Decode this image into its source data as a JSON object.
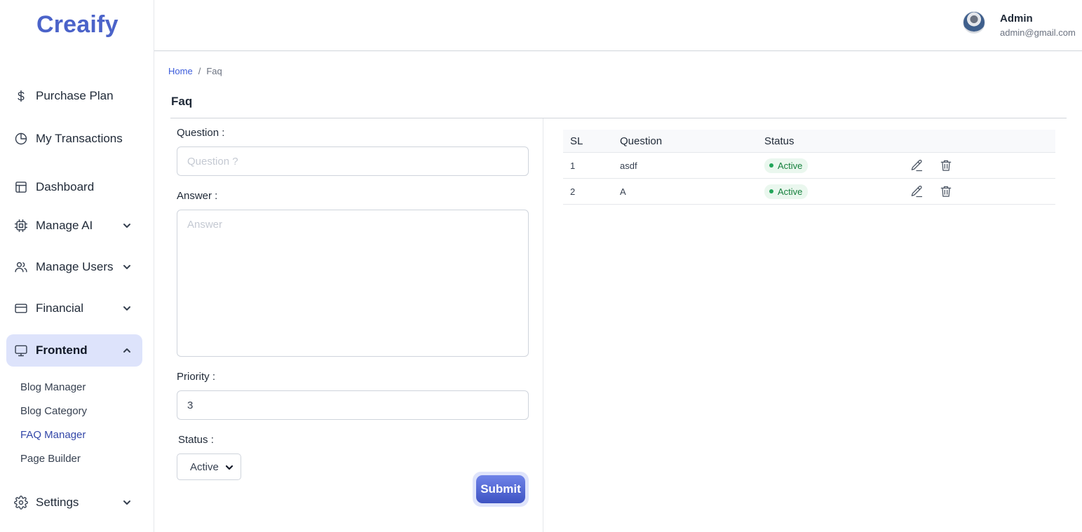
{
  "brand": {
    "name": "Creaify"
  },
  "sidebar": {
    "items": [
      {
        "label": "Purchase Plan"
      },
      {
        "label": "My Transactions"
      },
      {
        "label": "Dashboard"
      },
      {
        "label": "Manage AI"
      },
      {
        "label": "Manage Users"
      },
      {
        "label": "Financial"
      },
      {
        "label": "Frontend"
      },
      {
        "label": "Settings"
      }
    ],
    "frontend_sub": [
      {
        "label": "Blog Manager"
      },
      {
        "label": "Blog Category"
      },
      {
        "label": "FAQ Manager"
      },
      {
        "label": "Page Builder"
      }
    ]
  },
  "user": {
    "name": "Admin",
    "email": "admin@gmail.com"
  },
  "breadcrumb": {
    "home": "Home",
    "separator": "/",
    "current": "Faq"
  },
  "page": {
    "title": "Faq"
  },
  "form": {
    "question_label": "Question :",
    "question_placeholder": "Question ?",
    "answer_label": "Answer :",
    "answer_placeholder": "Answer",
    "priority_label": "Priority :",
    "priority_value": "3",
    "status_label": "Status :",
    "status_value": "Active",
    "submit_label": "Submit"
  },
  "table": {
    "headers": {
      "sl": "SL",
      "question": "Question",
      "status": "Status"
    },
    "rows": [
      {
        "sl": "1",
        "question": "asdf",
        "status": "Active"
      },
      {
        "sl": "2",
        "question": "A",
        "status": "Active"
      }
    ]
  },
  "colors": {
    "accent": "#4b63c9",
    "active_nav_bg": "#dde3fb",
    "status_active": "#16803d"
  }
}
